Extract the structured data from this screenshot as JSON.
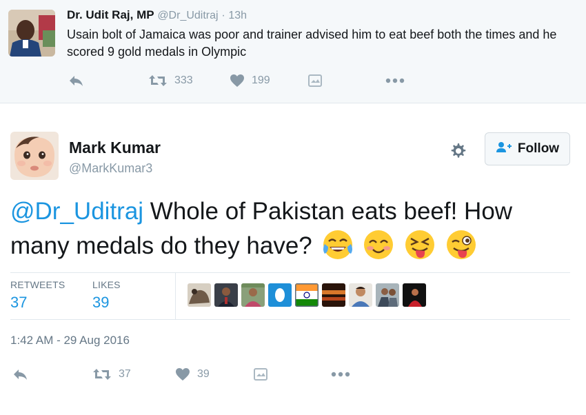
{
  "parent_tweet": {
    "author_name": "Dr. Udit Raj, MP",
    "handle": "@Dr_Uditraj",
    "separator": "·",
    "time": "13h",
    "text": "Usain bolt of Jamaica was poor and trainer advised him  to eat beef both the times and he scored 9 gold medals in Olympic",
    "actions": {
      "reply_icon": "reply-icon",
      "retweet_icon": "retweet-icon",
      "retweet_count": "333",
      "like_icon": "heart-icon",
      "like_count": "199",
      "moments_icon": "moments-icon",
      "more_icon": "more-icon"
    }
  },
  "main_tweet": {
    "author_name": "Mark Kumar",
    "handle": "@MarkKumar3",
    "follow_label": "Follow",
    "mention": "@Dr_Uditraj",
    "text": " Whole of Pakistan eats beef! How many medals do they have?",
    "emojis": [
      "face-with-tears-of-joy",
      "smiling-face-with-smiling-eyes",
      "squinting-face-with-tongue",
      "winking-face-with-tongue"
    ],
    "stats": {
      "retweets_label": "RETWEETS",
      "retweets_count": "37",
      "likes_label": "LIKES",
      "likes_count": "39"
    },
    "likers_count_shown": 10,
    "timestamp": "1:42 AM - 29 Aug 2016",
    "actions": {
      "retweet_count": "37",
      "like_count": "39"
    }
  },
  "colors": {
    "link_blue": "#1b95e0",
    "muted_gray": "#8899a6",
    "text_dark": "#14171a",
    "parent_bg": "#f5f8fa",
    "border": "#e1e8ed"
  }
}
